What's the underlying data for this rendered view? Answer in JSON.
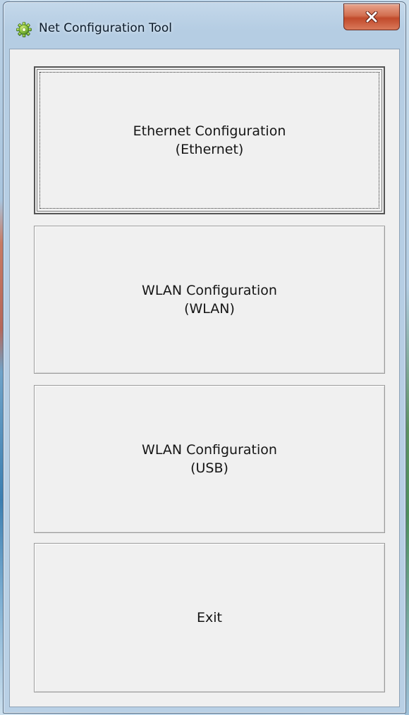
{
  "window": {
    "title": "Net Configuration Tool",
    "icon": "gear-app-icon",
    "close_label": "X",
    "close_icon": "close-icon"
  },
  "buttons": [
    {
      "line1": "Ethernet Configuration",
      "line2": "(Ethernet)",
      "focused": true
    },
    {
      "line1": "WLAN Configuration",
      "line2": "(WLAN)",
      "focused": false
    },
    {
      "line1": "WLAN Configuration",
      "line2": "(USB)",
      "focused": false
    },
    {
      "line1": "Exit",
      "line2": "",
      "focused": false
    }
  ],
  "colors": {
    "client_bg": "#f0f0f0",
    "close_red": "#c14a2b",
    "title_glass": "#b9d0e5"
  }
}
